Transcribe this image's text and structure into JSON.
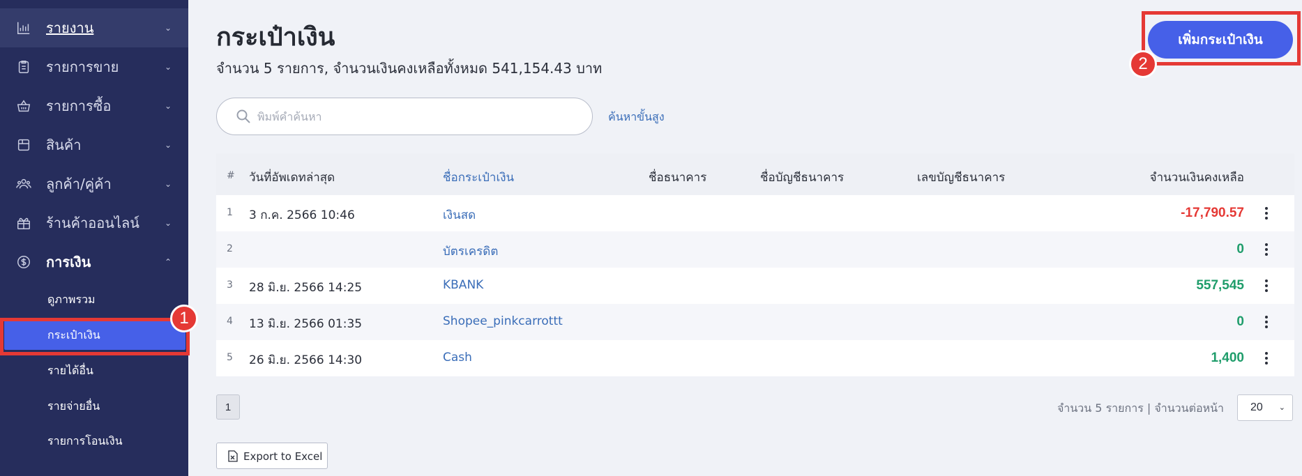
{
  "sidebar": {
    "items": [
      {
        "label": "รายงาน",
        "icon": "bar-chart-icon"
      },
      {
        "label": "รายการขาย",
        "icon": "clipboard-icon"
      },
      {
        "label": "รายการซื้อ",
        "icon": "basket-icon"
      },
      {
        "label": "สินค้า",
        "icon": "box-icon"
      },
      {
        "label": "ลูกค้า/คู่ค้า",
        "icon": "users-icon"
      },
      {
        "label": "ร้านค้าออนไลน์",
        "icon": "gift-icon"
      },
      {
        "label": "การเงิน",
        "icon": "dollar-circle-icon"
      }
    ],
    "finance_sub": [
      {
        "label": "ดูภาพรวม"
      },
      {
        "label": "กระเป๋าเงิน"
      },
      {
        "label": "รายได้อื่น"
      },
      {
        "label": "รายจ่ายอื่น"
      },
      {
        "label": "รายการโอนเงิน"
      }
    ]
  },
  "annotations": {
    "step1": "1",
    "step2": "2",
    "highlight_color": "#e53935"
  },
  "header": {
    "title": "กระเป๋าเงิน",
    "subtitle": "จำนวน 5 รายการ, จำนวนเงินคงเหลือทั้งหมด 541,154.43 บาท",
    "add_button": "เพิ่มกระเป๋าเงิน"
  },
  "search": {
    "placeholder": "พิมพ์คำค้นหา",
    "advanced_link": "ค้นหาขั้นสูง"
  },
  "table": {
    "headers": {
      "num": "#",
      "updated": "วันที่อัพเดทล่าสุด",
      "wallet": "ชื่อกระเป๋าเงิน",
      "bank": "ชื่อธนาคาร",
      "account_name": "ชื่อบัญชีธนาคาร",
      "account_no": "เลขบัญชีธนาคาร",
      "balance": "จำนวนเงินคงเหลือ"
    },
    "rows": [
      {
        "num": "1",
        "updated": "3 ก.ค. 2566 10:46",
        "wallet": "เงินสด",
        "balance": "-17,790.57"
      },
      {
        "num": "2",
        "updated": "",
        "wallet": "บัตรเครดิต",
        "balance": "0"
      },
      {
        "num": "3",
        "updated": "28 มิ.ย. 2566 14:25",
        "wallet": "KBANK",
        "balance": "557,545"
      },
      {
        "num": "4",
        "updated": "13 มิ.ย. 2566 01:35",
        "wallet": "Shopee_pinkcarrottt",
        "balance": "0"
      },
      {
        "num": "5",
        "updated": "26 มิ.ย. 2566 14:30",
        "wallet": "Cash",
        "balance": "1,400"
      }
    ]
  },
  "footer": {
    "page": "1",
    "info": "จำนวน 5 รายการ | จำนวนต่อหน้า",
    "per_page": "20",
    "export": "Export to Excel"
  },
  "colors": {
    "sidebar": "#262d5c",
    "accent": "#4660e8",
    "negative": "#e53935",
    "positive": "#1f9d6b",
    "link": "#3a6db8"
  }
}
